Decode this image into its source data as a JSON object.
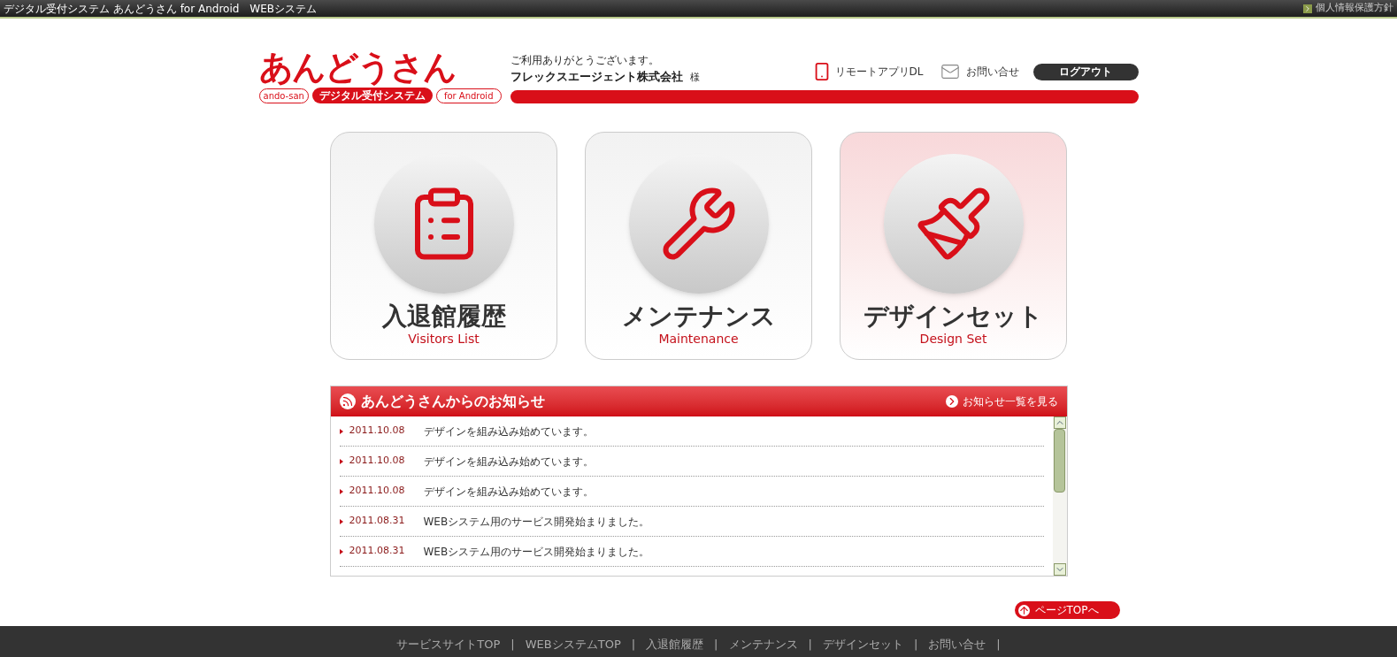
{
  "top_bar": {
    "title": "デジタル受付システム あんどうさん for Android　WEBシステム",
    "privacy_link": "個人情報保護方針"
  },
  "logo": {
    "main": "あんどうさん",
    "romaji": "ando-san",
    "subtitle": "デジタル受付システム",
    "platform": "for Android"
  },
  "greeting": {
    "line": "ご利用ありがとうございます。",
    "company": "フレックスエージェント株式会社",
    "honorific": "様"
  },
  "header_links": [
    {
      "kind": "app",
      "label": "リモートアプリDL"
    },
    {
      "kind": "mail",
      "label": "お問い合せ"
    }
  ],
  "logout": "ログアウト",
  "cards": [
    {
      "kind": "clipboard",
      "title": "入退館履歴",
      "subtitle": "Visitors List",
      "selected": false
    },
    {
      "kind": "tools",
      "title": "メンテナンス",
      "subtitle": "Maintenance",
      "selected": false
    },
    {
      "kind": "paint",
      "title": "デザインセット",
      "subtitle": "Design Set",
      "selected": true
    }
  ],
  "news": {
    "title": "あんどうさんからのお知らせ",
    "more_link": "お知らせ一覧を見る",
    "items": [
      {
        "date": "2011.10.08",
        "text": "デザインを組み込み始めています。"
      },
      {
        "date": "2011.10.08",
        "text": "デザインを組み込み始めています。"
      },
      {
        "date": "2011.10.08",
        "text": "デザインを組み込み始めています。"
      },
      {
        "date": "2011.08.31",
        "text": "WEBシステム用のサービス開発始まりました。"
      },
      {
        "date": "2011.08.31",
        "text": "WEBシステム用のサービス開発始まりました。"
      }
    ]
  },
  "page_top": "ページTOPへ",
  "footer": {
    "separator": "|",
    "links": [
      "サービスサイトTOP",
      "WEBシステムTOP",
      "入退館履歴",
      "メンテナンス",
      "デザインセット",
      "お問い合せ"
    ]
  }
}
